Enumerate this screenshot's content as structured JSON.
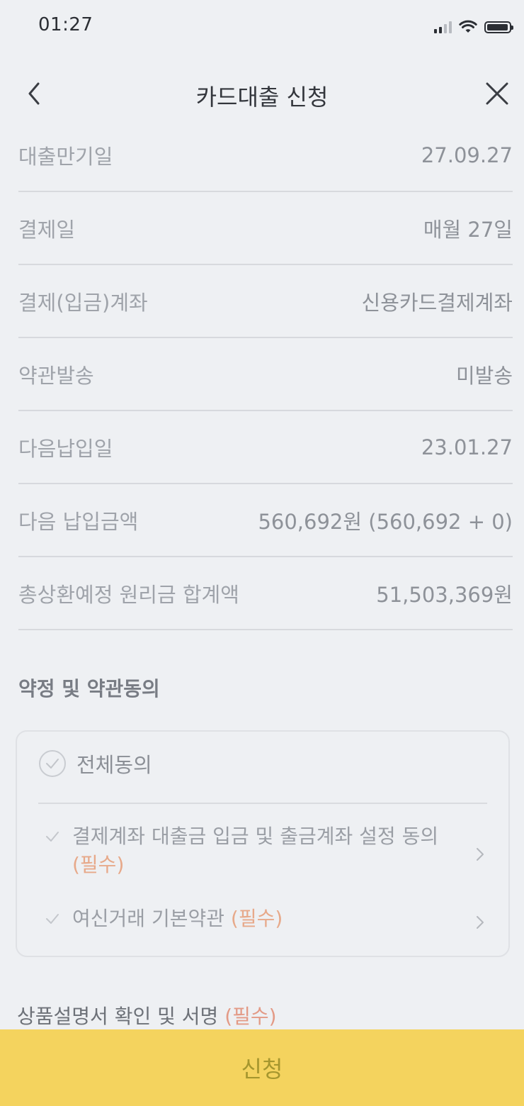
{
  "status_bar": {
    "time": "01:27"
  },
  "header": {
    "title": "카드대출 신청"
  },
  "info_rows": [
    {
      "label": "대출만기일",
      "value": "27.09.27"
    },
    {
      "label": "결제일",
      "value": "매월 27일"
    },
    {
      "label": "결제(입금)계좌",
      "value": "신용카드결제계좌"
    },
    {
      "label": "약관발송",
      "value": "미발송"
    },
    {
      "label": "다음납입일",
      "value": "23.01.27"
    },
    {
      "label": "다음 납입금액",
      "value": "560,692원 (560,692 + 0)"
    },
    {
      "label": "총상환예정 원리금 합계액",
      "value": "51,503,369원"
    }
  ],
  "agreement": {
    "title": "약정 및 약관동의",
    "all_label": "전체동의",
    "items": [
      {
        "text": "결제계좌 대출금 입금 및 출금계좌 설정 동의",
        "required": "(필수)"
      },
      {
        "text": "여신거래 기본약관",
        "required": "(필수)"
      }
    ]
  },
  "signature": {
    "title": "상품설명서 확인 및 서명",
    "required": "(필수)"
  },
  "footer": {
    "apply_label": "신청"
  },
  "colors": {
    "accent": "#f4d35e",
    "required": "#e7a98a"
  },
  "icons": [
    "back-arrow-icon",
    "close-icon",
    "check-circle-icon",
    "check-icon",
    "chevron-right-icon",
    "signal-icon",
    "wifi-icon",
    "battery-icon"
  ]
}
